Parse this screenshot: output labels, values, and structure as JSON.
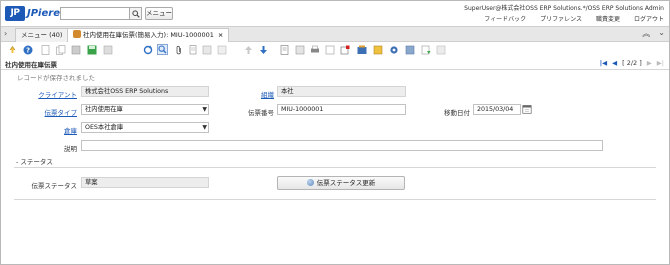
{
  "header": {
    "logo_mark": "JP",
    "logo_text": "JPiere",
    "search_value": "",
    "menu_label": "メニュー",
    "user_info": "SuperUser@株式会社OSS ERP Solutions.*/OSS ERP Solutions Admin",
    "links": [
      "フィードバック",
      "プリファレンス",
      "職責変更",
      "ログアウト"
    ]
  },
  "tabs": [
    {
      "label": "メニュー (40)"
    },
    {
      "label": "社内使用在庫伝票(簡易入力): MIU-1000001",
      "close": "×"
    }
  ],
  "window": {
    "title": "社内使用在庫伝票",
    "record_nav": "[ 2/2 ]",
    "status_message": "レコードが保存されました"
  },
  "form": {
    "client_label": "クライアント",
    "client_value": "株式会社OSS ERP Solutions",
    "org_label": "組織",
    "org_value": "本社",
    "doctype_label": "伝票タイプ",
    "doctype_value": "社内使用在庫",
    "docno_label": "伝票番号",
    "docno_value": "MIU-1000001",
    "movedate_label": "移動日付",
    "movedate_value": "2015/03/04",
    "warehouse_label": "倉庫",
    "warehouse_value": "OES本社倉庫",
    "description_label": "説明",
    "description_value": ""
  },
  "status_section": {
    "title": "- ステータス",
    "docstatus_label": "伝票ステータス",
    "docstatus_value": "草案",
    "process_button": "伝票ステータス更新"
  },
  "colors": {
    "accent": "#1d5ab8",
    "readonly_field": "#ededed",
    "tabbar": "#e7e7e7"
  },
  "toolbar_icons": [
    "undo-icon",
    "help-icon",
    "new-record-icon",
    "copy-record-icon",
    "delete-icon",
    "save-icon",
    "refresh-icon",
    "find-icon",
    "attachment-icon",
    "chat-icon",
    "grid-toggle-icon",
    "parent-record-icon",
    "detail-record-icon",
    "report-icon",
    "print-icon",
    "archive-icon",
    "zoom-across-icon",
    "request-icon",
    "product-info-icon",
    "workflow-icon",
    "settings-icon",
    "export-icon",
    "customize-icon"
  ]
}
